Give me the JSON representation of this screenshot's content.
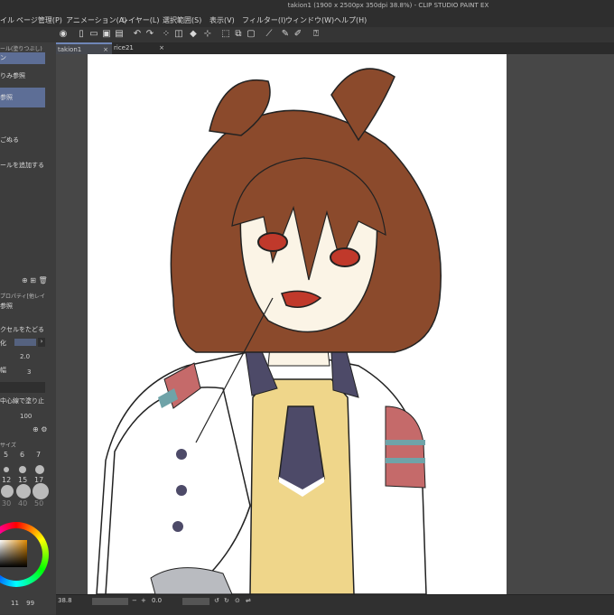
{
  "window": {
    "title": "takion1 (1900 x 2500px 350dpi 38.8%) - CLIP STUDIO PAINT EX"
  },
  "menu": [
    "イル",
    "ページ管理(P)",
    "アニメーション(A)",
    "レイヤー(L)",
    "選択範囲(S)",
    "表示(V)",
    "フィルター(I)",
    "ウィンドウ(W)",
    "ヘルプ(H)"
  ],
  "tabs": [
    {
      "label": "takion1",
      "active": true
    },
    {
      "label": "rice21",
      "active": false
    }
  ],
  "left_panel": {
    "tool_header": "ール(塗りつぶし)",
    "sub_tools": [
      "ン",
      "りみ参照",
      "参照",
      "",
      "ごぬる"
    ],
    "add_tool": "ールを追加する",
    "property_header": "プロパティ[他レイヤー参",
    "property_title": "参照",
    "prop_rows": [
      "クセルをたどる",
      "化",
      "",
      "幅",
      "",
      "中心線で塗り止まる"
    ],
    "values": [
      "2.0",
      "3",
      "100"
    ],
    "brush_size_header": "サイズ",
    "brush_sizes": [
      "5",
      "6",
      "7",
      "12",
      "15",
      "17",
      "30",
      "40",
      "50"
    ],
    "color_nums": [
      "11",
      "99"
    ]
  },
  "status": {
    "zoom": "38.8",
    "angle": "0.0"
  },
  "colors": {
    "hair": "#8b4a2c",
    "skin": "#fbf4e6",
    "eyes": "#c0392b",
    "vest": "#efd68a",
    "tie": "#4d4a68",
    "stripe_red": "#c56a6a",
    "stripe_teal": "#6fa3a8",
    "coat": "#ffffff"
  }
}
